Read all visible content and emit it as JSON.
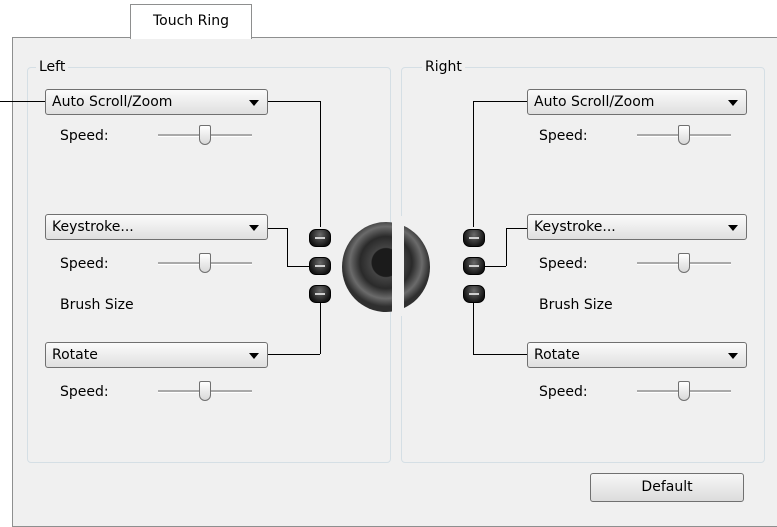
{
  "tab": {
    "label": "Touch Ring"
  },
  "left": {
    "title": "Left",
    "row1": {
      "value": "Auto Scroll/Zoom",
      "speed_label": "Speed:",
      "speed": 0.5
    },
    "row2": {
      "value": "Keystroke...",
      "speed_label": "Speed:",
      "speed": 0.5,
      "extra_label": "Brush Size"
    },
    "row3": {
      "value": "Rotate",
      "speed_label": "Speed:",
      "speed": 0.5
    }
  },
  "right": {
    "title": "Right",
    "row1": {
      "value": "Auto Scroll/Zoom",
      "speed_label": "Speed:",
      "speed": 0.5
    },
    "row2": {
      "value": "Keystroke...",
      "speed_label": "Speed:",
      "speed": 0.5,
      "extra_label": "Brush Size"
    },
    "row3": {
      "value": "Rotate",
      "speed_label": "Speed:",
      "speed": 0.5
    }
  },
  "default_button": {
    "label": "Default"
  }
}
